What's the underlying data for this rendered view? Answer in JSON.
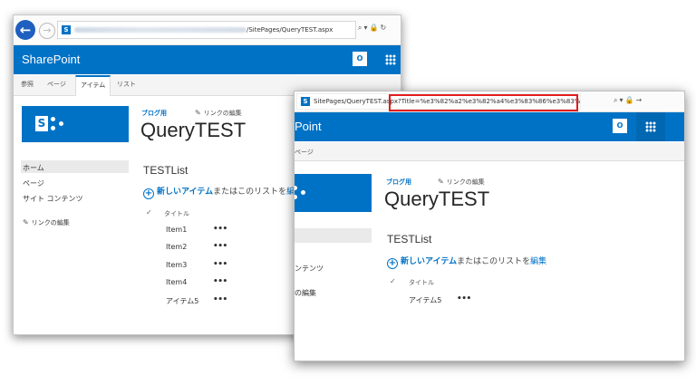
{
  "window1": {
    "url_visible": "/SitePages/QueryTEST.aspx",
    "brand": "SharePoint",
    "outlook_icon_text": "O",
    "ribbon_tabs": [
      "参照",
      "ページ",
      "アイテム",
      "リスト"
    ],
    "logo_letter": "S",
    "blog_part": "ブログ用",
    "edit_links": "リンクの編集",
    "page_title": "QueryTEST",
    "nav": [
      "ホーム",
      "ページ",
      "サイト コンテンツ"
    ],
    "nav_edit_links": "リンクの編集",
    "list_title": "TESTList",
    "new_item": "新しいアイテム",
    "new_item_mid": "またはこのリストを",
    "new_item_edit": "編集",
    "column_title": "タイトル",
    "items": [
      "Item1",
      "Item2",
      "Item3",
      "Item4",
      "アイテム5"
    ],
    "ellipsis": "•••"
  },
  "window2": {
    "url_prefix": "SitePages/QueryTEST.aspx",
    "url_query": "?Title=%e3%82%a2%e3%82%a4%e3%83%86%e3%83%a05",
    "brand_fragment": "Point",
    "outlook_icon_text": "O",
    "ribbon_fragment": "ページ",
    "blog_part": "ブログ用",
    "edit_links": "リンクの編集",
    "page_title": "QueryTEST",
    "nav": [
      "ンテンツ",
      "の編集"
    ],
    "list_title": "TESTList",
    "new_item": "新しいアイテム",
    "new_item_mid": "またはこのリストを",
    "new_item_edit": "編集",
    "column_title": "タイトル",
    "items": [
      "アイテム5"
    ],
    "ellipsis": "•••"
  },
  "colors": {
    "sharepoint_blue": "#0072c6",
    "highlight_red": "#e21d1d"
  },
  "icons": [
    "back-arrow-icon",
    "forward-arrow-icon",
    "search-icon",
    "lock-icon",
    "refresh-icon",
    "outlook-icon",
    "app-launcher-icon",
    "pencil-icon",
    "plus-circle-icon",
    "check-icon",
    "favicon"
  ]
}
